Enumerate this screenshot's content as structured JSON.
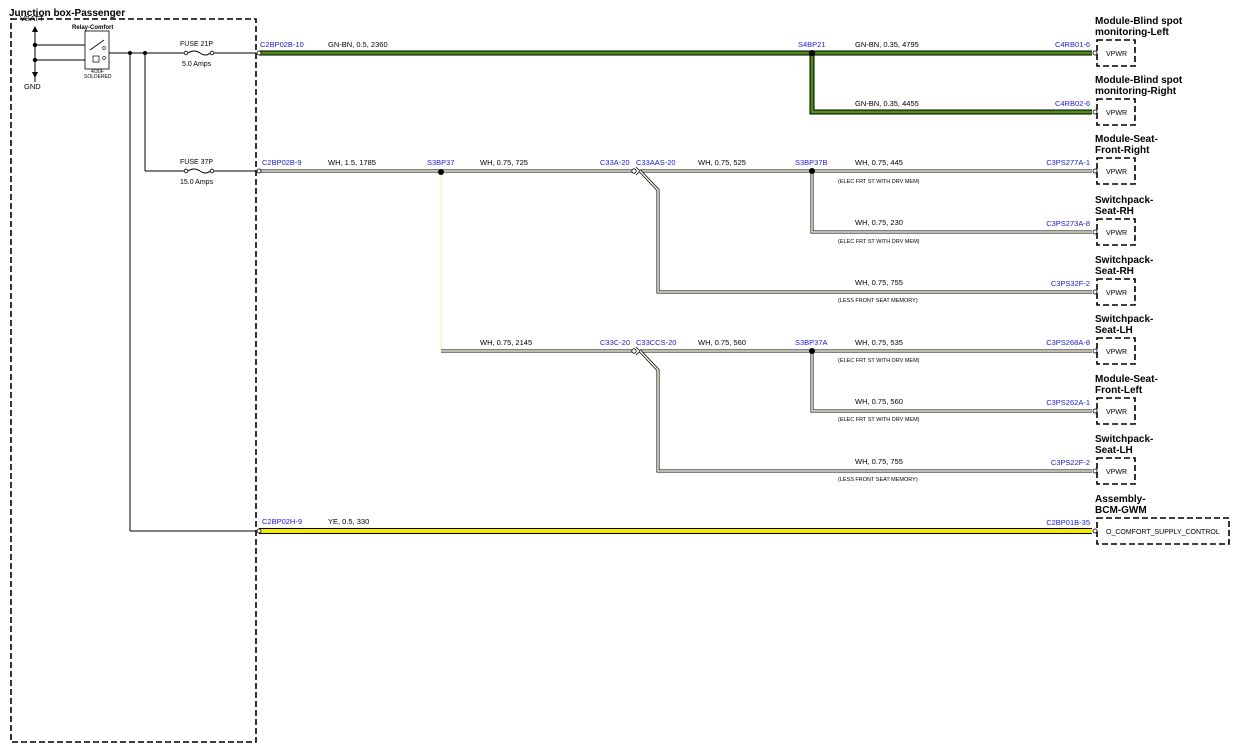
{
  "junction_box": {
    "title": "Junction box-Passenger",
    "vbatt": "VBATT",
    "gnd": "GND",
    "relay_label": "Relay-Comfort",
    "relay_note_1": "4/30F",
    "relay_note_2": "SOLDERED"
  },
  "fuses": [
    {
      "name": "FUSE 21P",
      "rating": "5.0 Amps"
    },
    {
      "name": "FUSE 37P",
      "rating": "15.0 Amps"
    }
  ],
  "wires": {
    "w1": {
      "pin": "C2BP02B-10",
      "spec": "GN-BN,  0.5,  2360",
      "color": "#4d8c1a"
    },
    "w1a": {
      "spec": "GN-BN,  0.35,  4795"
    },
    "w1b": {
      "spec": "GN-BN,  0.35,  4455"
    },
    "splice1": "S4BP21",
    "w2": {
      "pin": "C2BP02B-9",
      "spec": "WH,  1.5,  1785"
    },
    "splice2": "S3BP37",
    "w2a": {
      "spec": "WH,  0.75,  725"
    },
    "conn_a_left": "C33A-20",
    "conn_a_right": "C33AAS-20",
    "w2a2": {
      "spec": "WH,  0.75,  525"
    },
    "splice3": "S3BP37B",
    "w3a": {
      "spec": "WH,  0.75,  445",
      "note": "(ELEC FRT ST WITH DRV MEM)"
    },
    "w3b": {
      "spec": "WH,  0.75,  230",
      "note": "(ELEC FRT ST WITH DRV MEM)"
    },
    "w3c": {
      "spec": "WH,  0.75,  755",
      "note": "(LESS FRONT SEAT MEMORY)"
    },
    "w2b": {
      "spec": "WH,  0.75,  2145"
    },
    "conn_c_left": "C33C-20",
    "conn_c_right": "C33CCS-20",
    "w2b2": {
      "spec": "WH,  0.75,  560"
    },
    "splice4": "S3BP37A",
    "w4a": {
      "spec": "WH,  0.75,  535",
      "note": "(ELEC FRT ST WITH DRV MEM)"
    },
    "w4b": {
      "spec": "WH,  0.75,  560",
      "note": "(ELEC FRT ST WITH DRV MEM)"
    },
    "w4c": {
      "spec": "WH,  0.75,  755",
      "note": "(LESS FRONT SEAT MEMORY)"
    },
    "w5": {
      "pin": "C2BP02H-9",
      "spec": "YE,  0.5,  330",
      "color": "#f2ea00"
    }
  },
  "modules": [
    {
      "line1": "Module-Blind spot",
      "line2": "monitoring-Left",
      "pin": "C4RB01-6",
      "signal": "VPWR"
    },
    {
      "line1": "Module-Blind spot",
      "line2": "monitoring-Right",
      "pin": "C4RB02-6",
      "signal": "VPWR"
    },
    {
      "line1": "Module-Seat-",
      "line2": "Front-Right",
      "pin": "C3PS277A-1",
      "signal": "VPWR"
    },
    {
      "line1": "Switchpack-",
      "line2": "Seat-RH",
      "pin": "C3PS273A-8",
      "signal": "VPWR"
    },
    {
      "line1": "Switchpack-",
      "line2": "Seat-RH",
      "pin": "C3PS32F-2",
      "signal": "VPWR"
    },
    {
      "line1": "Switchpack-",
      "line2": "Seat-LH",
      "pin": "C3PS268A-8",
      "signal": "VPWR"
    },
    {
      "line1": "Module-Seat-",
      "line2": "Front-Left",
      "pin": "C3PS262A-1",
      "signal": "VPWR"
    },
    {
      "line1": "Switchpack-",
      "line2": "Seat-LH",
      "pin": "C3PS22F-2",
      "signal": "VPWR"
    },
    {
      "line1": "Assembly-",
      "line2": "BCM-GWM",
      "pin": "C2BP01B-35",
      "signal": "O_COMFORT_SUPPLY_CONTROL"
    }
  ]
}
